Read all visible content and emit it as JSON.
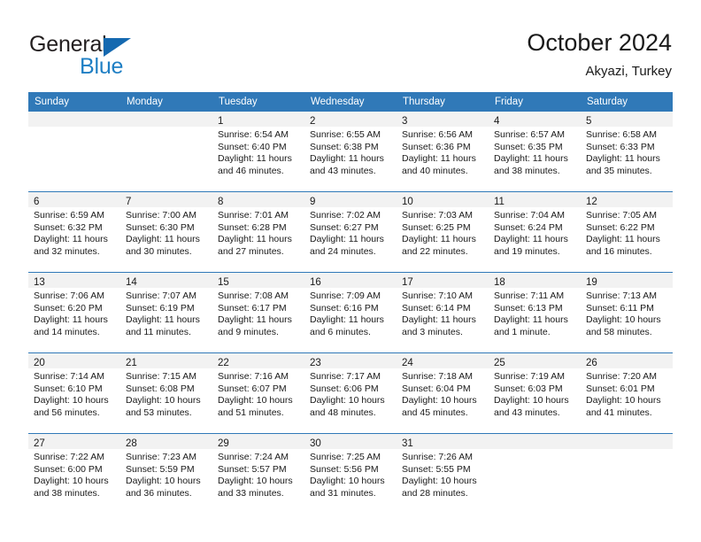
{
  "brand": {
    "name_part1": "General",
    "name_part2": "Blue",
    "logo_icon": "blue-triangle-icon",
    "accent_color": "#1f7fc4",
    "triangle_color": "#1569b0"
  },
  "header": {
    "title": "October 2024",
    "subtitle": "Akyazi, Turkey"
  },
  "calendar": {
    "header_bg_color": "#3079b8",
    "daynum_band_color": "#f2f2f2",
    "weekday_headers": [
      "Sunday",
      "Monday",
      "Tuesday",
      "Wednesday",
      "Thursday",
      "Friday",
      "Saturday"
    ],
    "weeks": [
      [
        {
          "day": "",
          "lines": []
        },
        {
          "day": "",
          "lines": []
        },
        {
          "day": "1",
          "lines": [
            "Sunrise: 6:54 AM",
            "Sunset: 6:40 PM",
            "Daylight: 11 hours",
            "and 46 minutes."
          ]
        },
        {
          "day": "2",
          "lines": [
            "Sunrise: 6:55 AM",
            "Sunset: 6:38 PM",
            "Daylight: 11 hours",
            "and 43 minutes."
          ]
        },
        {
          "day": "3",
          "lines": [
            "Sunrise: 6:56 AM",
            "Sunset: 6:36 PM",
            "Daylight: 11 hours",
            "and 40 minutes."
          ]
        },
        {
          "day": "4",
          "lines": [
            "Sunrise: 6:57 AM",
            "Sunset: 6:35 PM",
            "Daylight: 11 hours",
            "and 38 minutes."
          ]
        },
        {
          "day": "5",
          "lines": [
            "Sunrise: 6:58 AM",
            "Sunset: 6:33 PM",
            "Daylight: 11 hours",
            "and 35 minutes."
          ]
        }
      ],
      [
        {
          "day": "6",
          "lines": [
            "Sunrise: 6:59 AM",
            "Sunset: 6:32 PM",
            "Daylight: 11 hours",
            "and 32 minutes."
          ]
        },
        {
          "day": "7",
          "lines": [
            "Sunrise: 7:00 AM",
            "Sunset: 6:30 PM",
            "Daylight: 11 hours",
            "and 30 minutes."
          ]
        },
        {
          "day": "8",
          "lines": [
            "Sunrise: 7:01 AM",
            "Sunset: 6:28 PM",
            "Daylight: 11 hours",
            "and 27 minutes."
          ]
        },
        {
          "day": "9",
          "lines": [
            "Sunrise: 7:02 AM",
            "Sunset: 6:27 PM",
            "Daylight: 11 hours",
            "and 24 minutes."
          ]
        },
        {
          "day": "10",
          "lines": [
            "Sunrise: 7:03 AM",
            "Sunset: 6:25 PM",
            "Daylight: 11 hours",
            "and 22 minutes."
          ]
        },
        {
          "day": "11",
          "lines": [
            "Sunrise: 7:04 AM",
            "Sunset: 6:24 PM",
            "Daylight: 11 hours",
            "and 19 minutes."
          ]
        },
        {
          "day": "12",
          "lines": [
            "Sunrise: 7:05 AM",
            "Sunset: 6:22 PM",
            "Daylight: 11 hours",
            "and 16 minutes."
          ]
        }
      ],
      [
        {
          "day": "13",
          "lines": [
            "Sunrise: 7:06 AM",
            "Sunset: 6:20 PM",
            "Daylight: 11 hours",
            "and 14 minutes."
          ]
        },
        {
          "day": "14",
          "lines": [
            "Sunrise: 7:07 AM",
            "Sunset: 6:19 PM",
            "Daylight: 11 hours",
            "and 11 minutes."
          ]
        },
        {
          "day": "15",
          "lines": [
            "Sunrise: 7:08 AM",
            "Sunset: 6:17 PM",
            "Daylight: 11 hours",
            "and 9 minutes."
          ]
        },
        {
          "day": "16",
          "lines": [
            "Sunrise: 7:09 AM",
            "Sunset: 6:16 PM",
            "Daylight: 11 hours",
            "and 6 minutes."
          ]
        },
        {
          "day": "17",
          "lines": [
            "Sunrise: 7:10 AM",
            "Sunset: 6:14 PM",
            "Daylight: 11 hours",
            "and 3 minutes."
          ]
        },
        {
          "day": "18",
          "lines": [
            "Sunrise: 7:11 AM",
            "Sunset: 6:13 PM",
            "Daylight: 11 hours",
            "and 1 minute."
          ]
        },
        {
          "day": "19",
          "lines": [
            "Sunrise: 7:13 AM",
            "Sunset: 6:11 PM",
            "Daylight: 10 hours",
            "and 58 minutes."
          ]
        }
      ],
      [
        {
          "day": "20",
          "lines": [
            "Sunrise: 7:14 AM",
            "Sunset: 6:10 PM",
            "Daylight: 10 hours",
            "and 56 minutes."
          ]
        },
        {
          "day": "21",
          "lines": [
            "Sunrise: 7:15 AM",
            "Sunset: 6:08 PM",
            "Daylight: 10 hours",
            "and 53 minutes."
          ]
        },
        {
          "day": "22",
          "lines": [
            "Sunrise: 7:16 AM",
            "Sunset: 6:07 PM",
            "Daylight: 10 hours",
            "and 51 minutes."
          ]
        },
        {
          "day": "23",
          "lines": [
            "Sunrise: 7:17 AM",
            "Sunset: 6:06 PM",
            "Daylight: 10 hours",
            "and 48 minutes."
          ]
        },
        {
          "day": "24",
          "lines": [
            "Sunrise: 7:18 AM",
            "Sunset: 6:04 PM",
            "Daylight: 10 hours",
            "and 45 minutes."
          ]
        },
        {
          "day": "25",
          "lines": [
            "Sunrise: 7:19 AM",
            "Sunset: 6:03 PM",
            "Daylight: 10 hours",
            "and 43 minutes."
          ]
        },
        {
          "day": "26",
          "lines": [
            "Sunrise: 7:20 AM",
            "Sunset: 6:01 PM",
            "Daylight: 10 hours",
            "and 41 minutes."
          ]
        }
      ],
      [
        {
          "day": "27",
          "lines": [
            "Sunrise: 7:22 AM",
            "Sunset: 6:00 PM",
            "Daylight: 10 hours",
            "and 38 minutes."
          ]
        },
        {
          "day": "28",
          "lines": [
            "Sunrise: 7:23 AM",
            "Sunset: 5:59 PM",
            "Daylight: 10 hours",
            "and 36 minutes."
          ]
        },
        {
          "day": "29",
          "lines": [
            "Sunrise: 7:24 AM",
            "Sunset: 5:57 PM",
            "Daylight: 10 hours",
            "and 33 minutes."
          ]
        },
        {
          "day": "30",
          "lines": [
            "Sunrise: 7:25 AM",
            "Sunset: 5:56 PM",
            "Daylight: 10 hours",
            "and 31 minutes."
          ]
        },
        {
          "day": "31",
          "lines": [
            "Sunrise: 7:26 AM",
            "Sunset: 5:55 PM",
            "Daylight: 10 hours",
            "and 28 minutes."
          ]
        },
        {
          "day": "",
          "lines": []
        },
        {
          "day": "",
          "lines": []
        }
      ]
    ]
  }
}
